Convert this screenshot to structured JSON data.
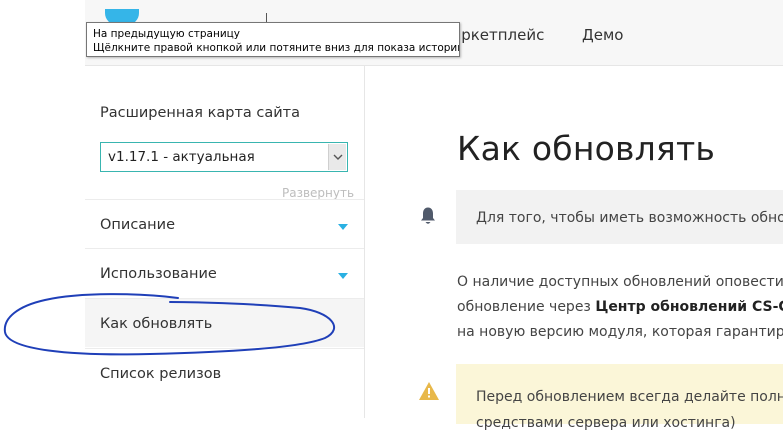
{
  "tooltip": {
    "line1": "На предыдущую страницу",
    "line2": "Щёлкните правой кнопкой или потяните вниз для показа истории"
  },
  "header": {
    "nav": [
      "аркетплейс",
      "Демо"
    ]
  },
  "sidebar": {
    "title": "Расширенная карта сайта",
    "version_select": {
      "value": "v1.17.1 - актуальная"
    },
    "expand_label": "Развернуть",
    "items": [
      {
        "label": "Описание",
        "has_caret": true
      },
      {
        "label": "Использование",
        "has_caret": true
      },
      {
        "label": "Как обновлять",
        "has_caret": false,
        "active": true
      },
      {
        "label": "Список релизов",
        "has_caret": false
      }
    ]
  },
  "main": {
    "title": "Как обновлять",
    "info_text": "Для того, чтобы иметь возможность обно",
    "paragraph": {
      "line1": "О наличие доступных обновлений оповести",
      "line2_prefix": "обновление через ",
      "line2_bold": "Центр обновлений CS-C",
      "line3": "на новую версию модуля, которая гарантир"
    },
    "warning": {
      "line1": "Перед обновлением всегда делайте полн",
      "line2": "средствами сервера или хостинга)"
    }
  },
  "colors": {
    "accent": "#2ab0e2",
    "select_border": "#39b5b0",
    "annotation": "#1f3fb8",
    "warning_bg": "#fbf6d8",
    "info_bg": "#f2f2f2"
  }
}
